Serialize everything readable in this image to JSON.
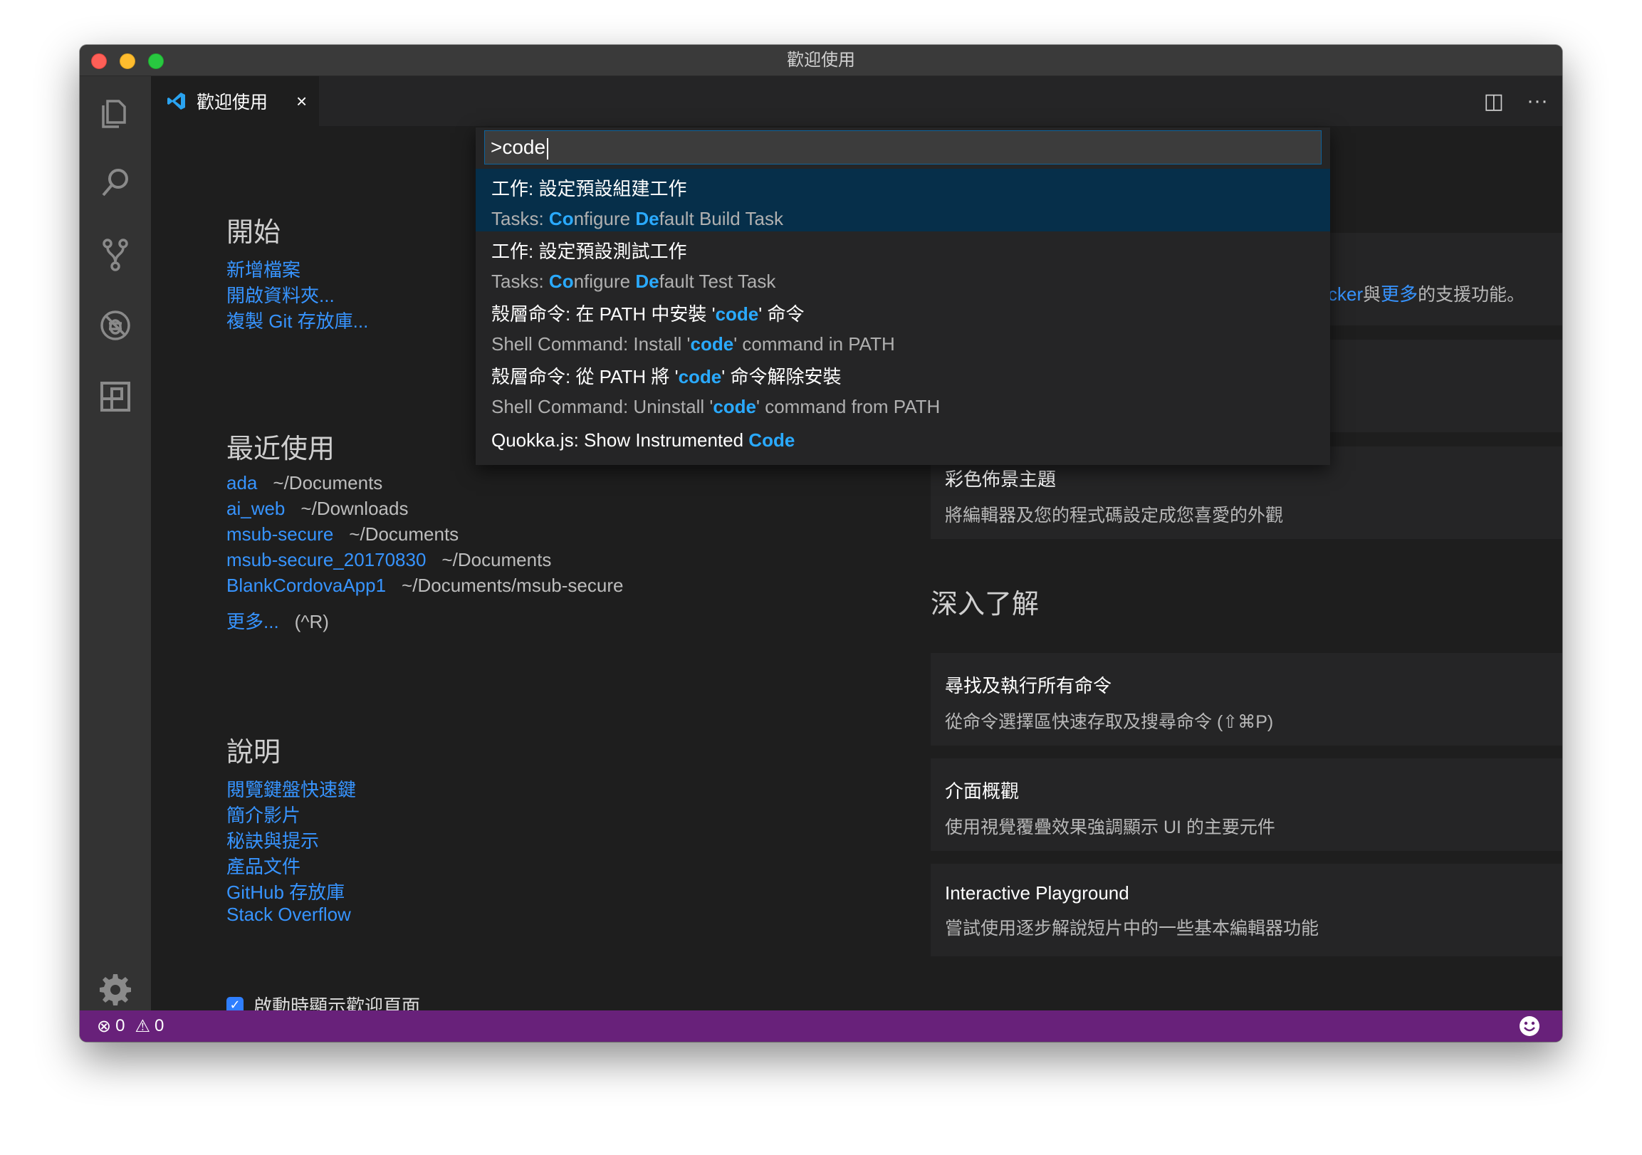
{
  "window": {
    "title": "歡迎使用"
  },
  "tab": {
    "label": "歡迎使用",
    "close": "×"
  },
  "tab_actions": {
    "split": "◫",
    "more": "···"
  },
  "quick_open": {
    "input_value": ">code",
    "items": [
      {
        "label": "工作: 設定預設組建工作",
        "detail_pre": "Tasks: ",
        "detail_h1": "Co",
        "detail_mid": "nfigure ",
        "detail_h2": "De",
        "detail_post": "fault Build Task",
        "selected": true
      },
      {
        "label": "工作: 設定預設測試工作",
        "detail_pre": "Tasks: ",
        "detail_h1": "Co",
        "detail_mid": "nfigure ",
        "detail_h2": "De",
        "detail_post": "fault Test Task",
        "selected": false
      },
      {
        "label_pre": "殼層命令: 在 PATH 中安裝 '",
        "label_h": "code",
        "label_post": "' 命令",
        "detail_pre": "Shell Command: Install '",
        "detail_h": "code",
        "detail_post": "' command in PATH"
      },
      {
        "label_pre": "殼層命令: 從 PATH 將 '",
        "label_h": "code",
        "label_post": "' 命令解除安裝",
        "detail_pre": "Shell Command: Uninstall '",
        "detail_h": "code",
        "detail_post": "' command from PATH"
      },
      {
        "label_pre": "Quokka.js: Show Instrumented ",
        "label_h": "Code"
      }
    ]
  },
  "start": {
    "title": "開始",
    "links": [
      "新增檔案",
      "開啟資料夾...",
      "複製 Git 存放庫..."
    ]
  },
  "recent": {
    "title": "最近使用",
    "items": [
      {
        "name": "ada",
        "path": "~/Documents"
      },
      {
        "name": "ai_web",
        "path": "~/Downloads"
      },
      {
        "name": "msub-secure",
        "path": "~/Documents"
      },
      {
        "name": "msub-secure_20170830",
        "path": "~/Documents"
      },
      {
        "name": "BlankCordovaApp1",
        "path": "~/Documents/msub-secure"
      }
    ],
    "more_label": "更多...",
    "more_shortcut": "(^R)"
  },
  "help": {
    "title": "說明",
    "links": [
      "閱覽鍵盤快速鍵",
      "簡介影片",
      "秘訣與提示",
      "產品文件",
      "GitHub 存放庫",
      "Stack Overflow"
    ]
  },
  "customize_partial": {
    "link1": "cker",
    "sep": "與",
    "link2": "更多",
    "suffix": "的支援功能。"
  },
  "customize_card": {
    "title": "彩色佈景主題",
    "desc": "將編輯器及您的程式碼設定成您喜愛的外觀"
  },
  "learn": {
    "title": "深入了解",
    "cards": [
      {
        "title": "尋找及執行所有命令",
        "desc": "從命令選擇區快速存取及搜尋命令 (⇧⌘P)"
      },
      {
        "title": "介面概觀",
        "desc": "使用視覺覆疊效果強調顯示 UI 的主要元件"
      },
      {
        "title": "Interactive Playground",
        "desc": "嘗試使用逐步解說短片中的一些基本編輯器功能"
      }
    ]
  },
  "startup_checkbox": {
    "label": "啟動時顯示歡迎頁面",
    "checked": true
  },
  "status": {
    "errors": "0",
    "warnings": "0"
  },
  "colors": {
    "accent": "#3794ff",
    "status_bar": "#68217a",
    "highlight": "#2aaaff"
  }
}
